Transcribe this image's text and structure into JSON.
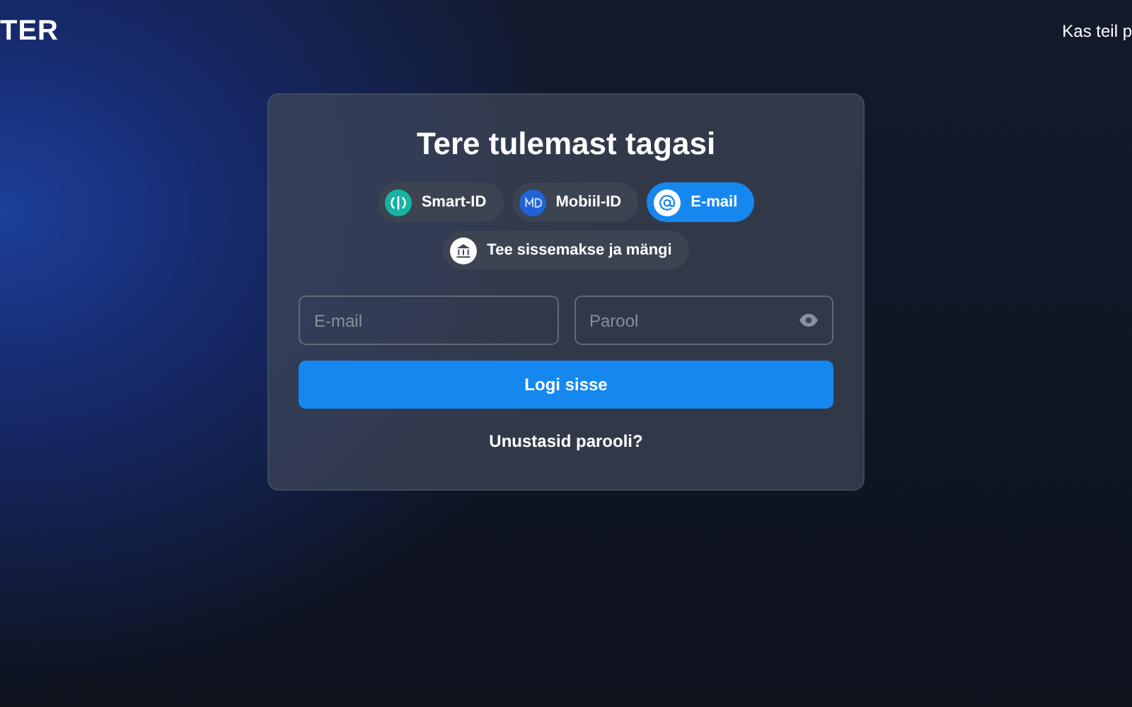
{
  "header": {
    "logo": "TER",
    "link": "Kas teil p"
  },
  "login": {
    "title": "Tere tulemast tagasi",
    "methods": [
      {
        "kind": "smartid",
        "label": "Smart-ID",
        "selected": false
      },
      {
        "kind": "mobiilid",
        "label": "Mobiil-ID",
        "selected": false
      },
      {
        "kind": "email",
        "label": "E-mail",
        "selected": true
      },
      {
        "kind": "bank",
        "label": "Tee sissemakse ja mängi",
        "selected": false
      }
    ],
    "fields": [
      {
        "kind": "email",
        "placeholder": "E-mail"
      },
      {
        "kind": "password",
        "placeholder": "Parool"
      }
    ],
    "submit": "Logi sisse",
    "forgot": "Unustasid parooli?"
  }
}
